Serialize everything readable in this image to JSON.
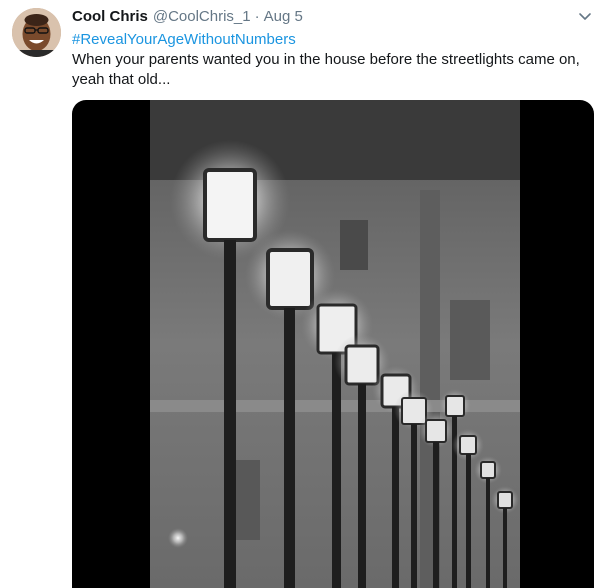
{
  "tweet": {
    "display_name": "Cool Chris",
    "handle": "@CoolChris_1",
    "separator": "·",
    "date": "Aug 5",
    "hashtag": "#RevealYourAgeWithoutNumbers",
    "text": "When your parents wanted you in the house before the streetlights came on, yeah that old..."
  },
  "icons": {
    "caret": "chevron-down-icon"
  },
  "colors": {
    "link": "#1b95e0",
    "name": "#14171a",
    "secondary": "#657786"
  }
}
